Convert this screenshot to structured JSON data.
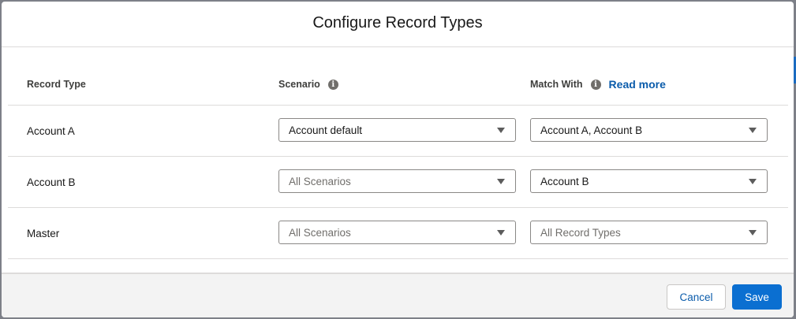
{
  "modal": {
    "title": "Configure Record Types"
  },
  "columns": {
    "record_type": "Record Type",
    "scenario": "Scenario",
    "match_with": "Match With",
    "read_more": "Read more"
  },
  "rows": [
    {
      "record_type": "Account A",
      "scenario": "Account default",
      "match_with": "Account A, Account B"
    },
    {
      "record_type": "Account B",
      "scenario": "All Scenarios",
      "match_with": "Account B"
    },
    {
      "record_type": "Master",
      "scenario": "All Scenarios",
      "match_with": "All Record Types"
    }
  ],
  "footer": {
    "cancel_label": "Cancel",
    "save_label": "Save"
  },
  "colors": {
    "brand": "#0b6fd1",
    "link": "#0b5cab"
  }
}
